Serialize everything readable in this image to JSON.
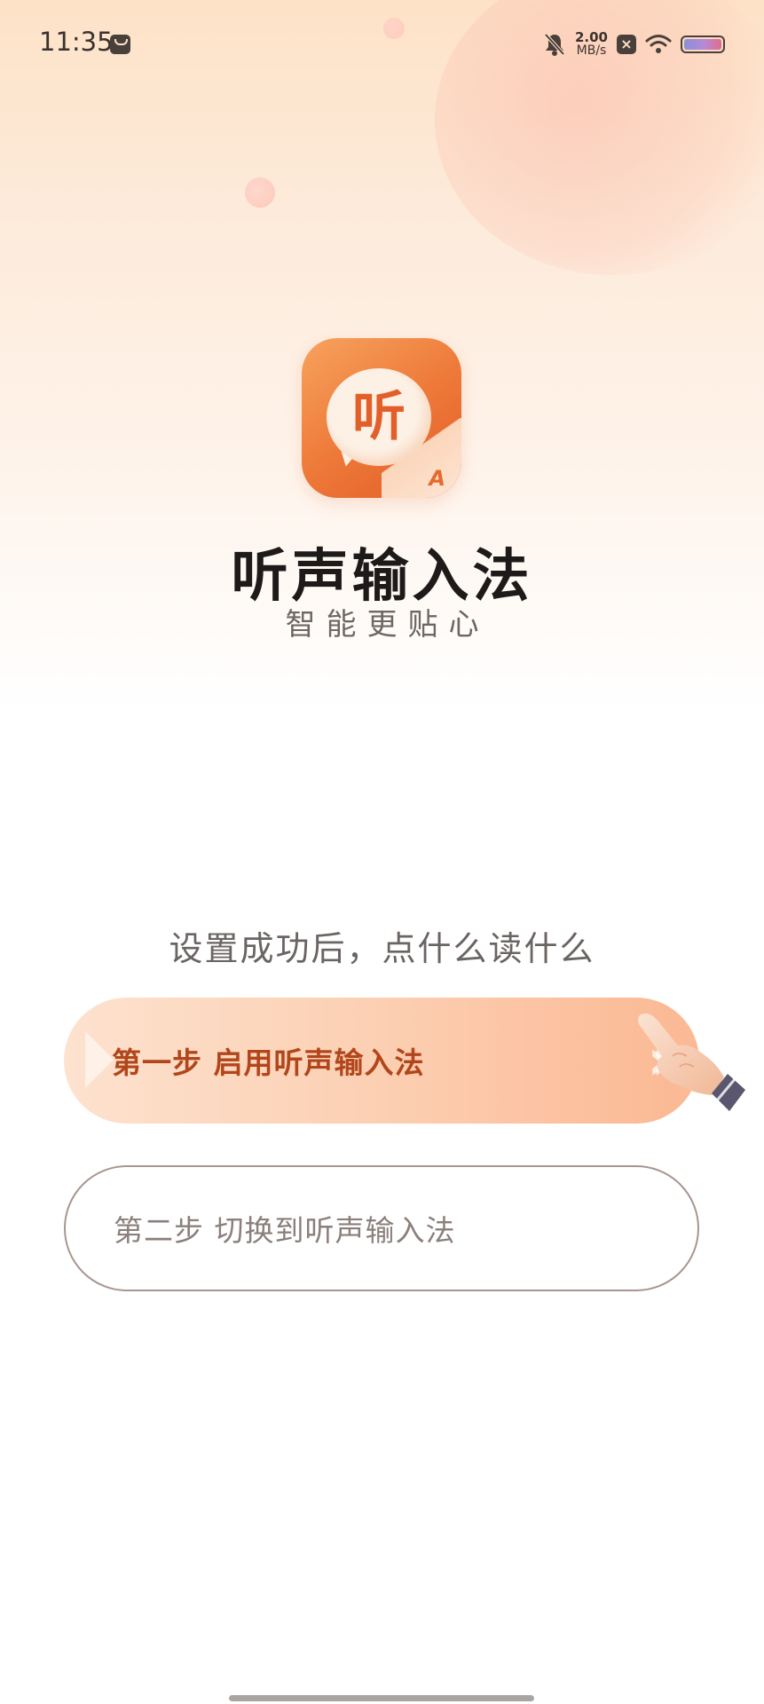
{
  "status_bar": {
    "time": "11:35",
    "net_speed_value": "2.00",
    "net_speed_unit": "MB/s",
    "battery_colors": [
      "#8a8fd8",
      "#b78ad3",
      "#e26c8a"
    ]
  },
  "app": {
    "logo_char": "听",
    "logo_badge": "A",
    "title": "听声输入法",
    "slogan": "智能更贴心",
    "brand_color": "#ee7a3a"
  },
  "guide": {
    "text": "设置成功后，点什么读什么"
  },
  "steps": [
    {
      "label": "第一步 启用听声输入法",
      "active": true,
      "text_color": "#b2461b"
    },
    {
      "label": "第二步 切换到听声输入法",
      "active": false,
      "text_color": "#8a7f7b"
    }
  ],
  "icons": {
    "status": [
      "bag-icon",
      "bell-off-icon",
      "sim-x-icon",
      "wifi-icon",
      "battery-icon"
    ],
    "step_arrow": "double-chevron-right-icon",
    "pointer": "hand-pointer-icon"
  }
}
